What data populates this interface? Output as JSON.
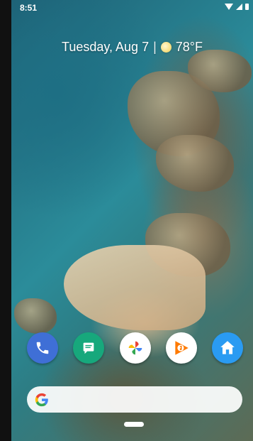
{
  "status_bar": {
    "time": "8:51",
    "icons": [
      "wifi-icon",
      "signal-icon",
      "battery-icon"
    ]
  },
  "at_a_glance": {
    "date": "Tuesday, Aug 7",
    "separator": "|",
    "temperature": "78°F",
    "weather_icon": "sunny-icon"
  },
  "dock": {
    "apps": [
      {
        "name": "Phone",
        "icon": "phone-icon",
        "color": "#3f6fd6"
      },
      {
        "name": "Messages",
        "icon": "messages-icon",
        "color": "#17a87c"
      },
      {
        "name": "Photos",
        "icon": "photos-icon",
        "color": "#ffffff"
      },
      {
        "name": "Play Music",
        "icon": "play-music-icon",
        "color": "#ffffff"
      },
      {
        "name": "Home",
        "icon": "home-app-icon",
        "color": "#2a9bf2"
      }
    ]
  },
  "search_bar": {
    "icon": "google-icon"
  },
  "navigation": {
    "home_handle": "home-pill"
  }
}
